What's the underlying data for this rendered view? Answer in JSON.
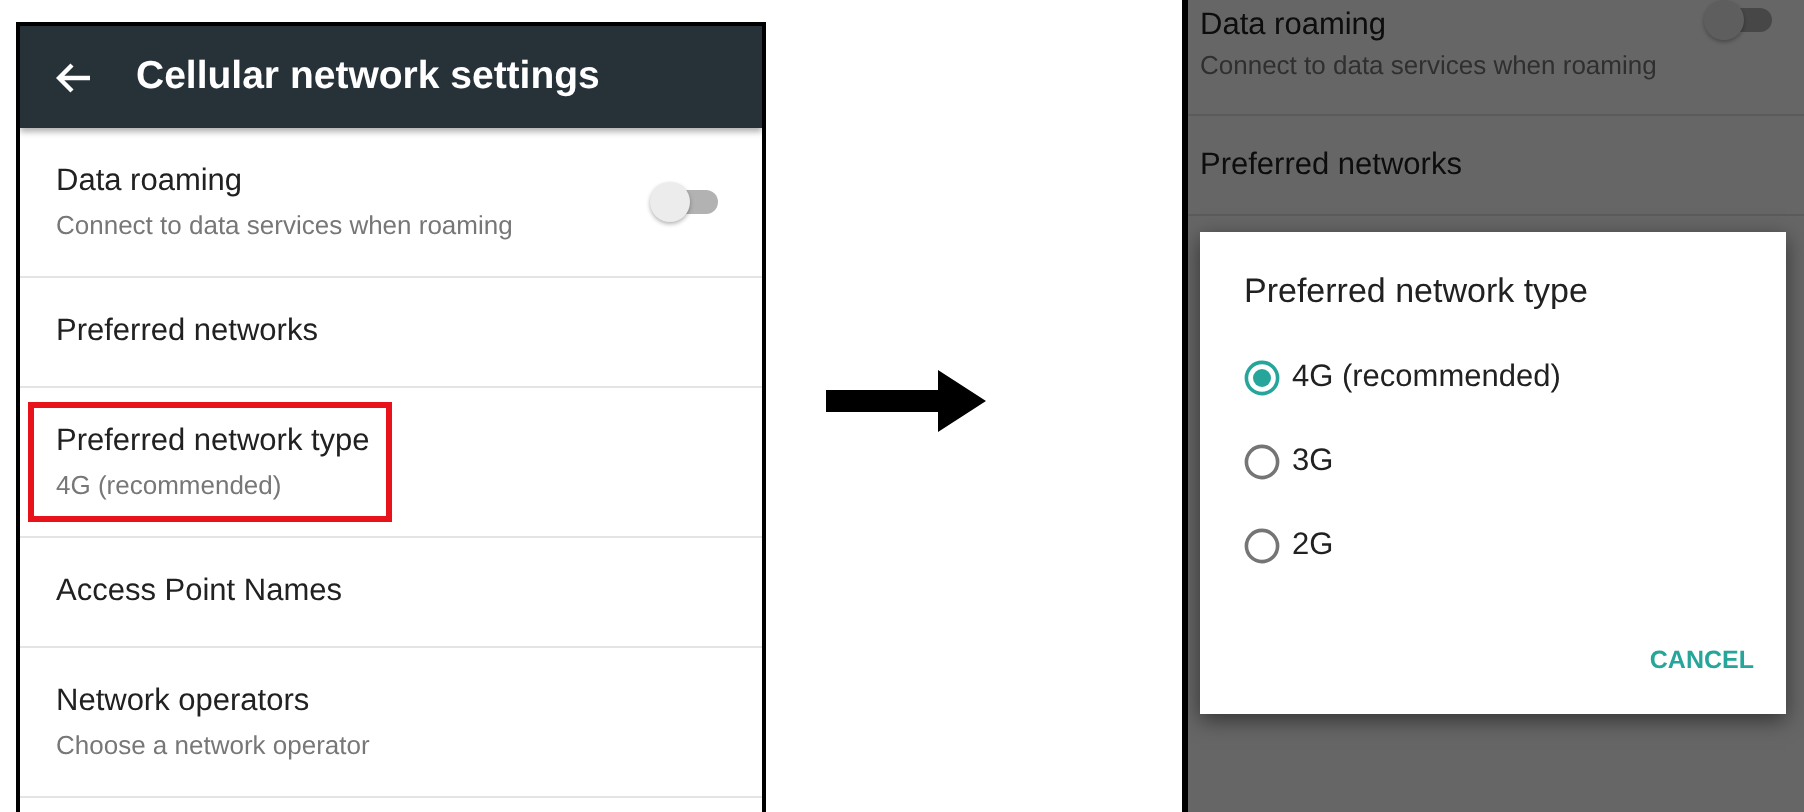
{
  "settings_screen": {
    "title": "Cellular network settings",
    "items": [
      {
        "kind": "toggle",
        "title": "Data roaming",
        "subtitle": "Connect to data services when roaming",
        "on": false,
        "highlighted": false
      },
      {
        "kind": "plain",
        "title": "Preferred networks",
        "highlighted": false
      },
      {
        "kind": "plain",
        "title": "Preferred network type",
        "subtitle": "4G (recommended)",
        "highlighted": true
      },
      {
        "kind": "plain",
        "title": "Access Point Names",
        "highlighted": false
      },
      {
        "kind": "plain",
        "title": "Network operators",
        "subtitle": "Choose a network operator",
        "highlighted": false
      }
    ]
  },
  "dialog_screen": {
    "background_items": [
      {
        "kind": "toggle",
        "title": "Data roaming",
        "subtitle": "Connect to data services when roaming",
        "on": false
      },
      {
        "kind": "plain",
        "title": "Preferred networks"
      }
    ],
    "dialog": {
      "title": "Preferred network type",
      "options": [
        {
          "label": "4G (recommended)",
          "selected": true
        },
        {
          "label": "3G",
          "selected": false
        },
        {
          "label": "2G",
          "selected": false
        }
      ],
      "buttons": [
        "CANCEL"
      ]
    }
  }
}
